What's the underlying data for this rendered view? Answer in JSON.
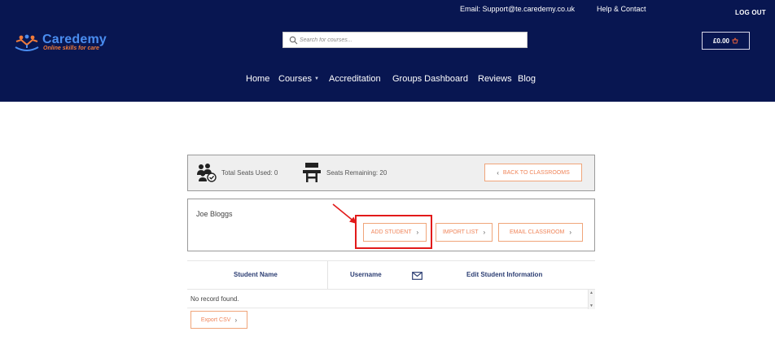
{
  "topbar": {
    "email": "Email: Support@te.caredemy.co.uk",
    "help": "Help & Contact",
    "logout": "LOG OUT"
  },
  "brand": {
    "name": "Caredemy",
    "tagline": "Online skills for care"
  },
  "search": {
    "placeholder": "Search for courses..."
  },
  "cart": {
    "total": "£0.00"
  },
  "nav": {
    "items": [
      "Home",
      "Courses",
      "Accreditation",
      "Groups Dashboard",
      "Reviews",
      "Blog"
    ]
  },
  "seats": {
    "used_label": "Total Seats Used: 0",
    "remaining_label": "Seats Remaining: 20",
    "back_label": "BACK TO CLASSROOMS"
  },
  "classroom": {
    "name": "Joe Bloggs",
    "add_student_label": "ADD STUDENT",
    "import_list_label": "IMPORT LIST",
    "email_classroom_label": "EMAIL CLASSROOM"
  },
  "table": {
    "columns": [
      "Student Name",
      "Username",
      "Edit Student Information"
    ],
    "empty_text": "No record found.",
    "export_label": "Export CSV"
  },
  "colors": {
    "header_bg": "#081651",
    "accent_orange": "#f0855a",
    "highlight_red": "#e21a1a",
    "brand_blue": "#4a8df0"
  }
}
